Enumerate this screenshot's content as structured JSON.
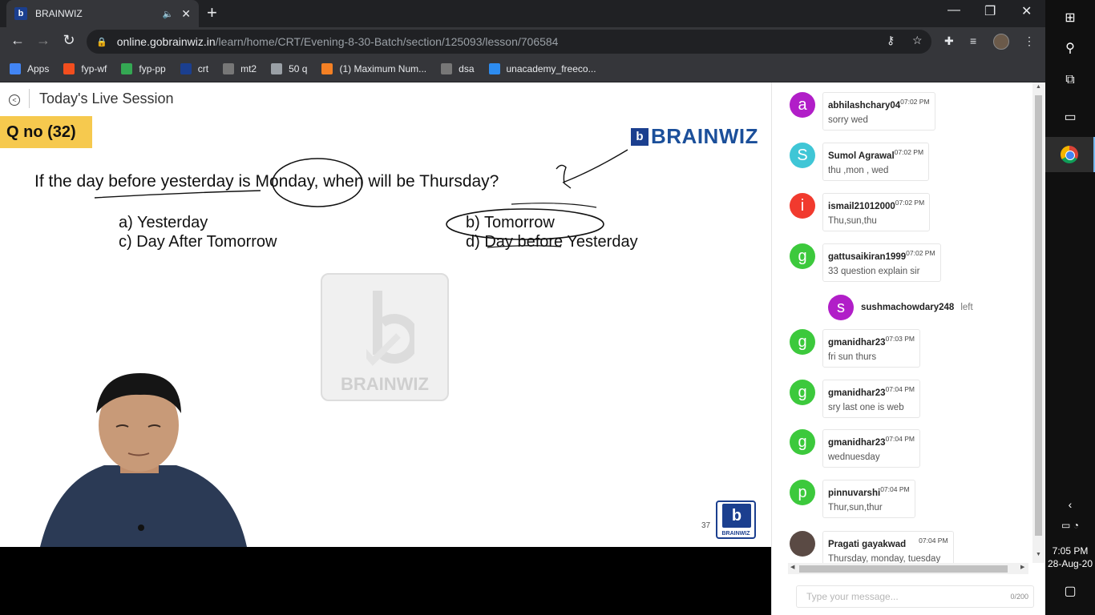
{
  "browser": {
    "tab_title": "BRAINWIZ",
    "url_host": "online.gobrainwiz.in",
    "url_path": "/learn/home/CRT/Evening-8-30-Batch/section/125093/lesson/706584",
    "bookmarks": [
      {
        "label": "Apps",
        "icon": "apps-grid-icon",
        "color": "#4285f4"
      },
      {
        "label": "fyp-wf",
        "icon": "figma-icon",
        "color": "#f24e1e"
      },
      {
        "label": "fyp-pp",
        "icon": "pp-icon",
        "color": "#34a853"
      },
      {
        "label": "crt",
        "icon": "brainwiz-icon",
        "color": "#1b3f8f"
      },
      {
        "label": "mt2",
        "icon": "cc-icon",
        "color": "#777777"
      },
      {
        "label": "50 q",
        "icon": "globe-icon",
        "color": "#9aa0a6"
      },
      {
        "label": "(1) Maximum Num...",
        "icon": "stackoverflow-icon",
        "color": "#f48024"
      },
      {
        "label": "dsa",
        "icon": "cc-icon",
        "color": "#777777"
      },
      {
        "label": "unacademy_freeco...",
        "icon": "unacademy-icon",
        "color": "#2d8cf0"
      }
    ]
  },
  "page": {
    "header_title": "Today's Live Session"
  },
  "slide": {
    "qno": "Q no (32)",
    "brand": "BRAINWIZ",
    "question": "If the day before yesterday is Monday, when will be Thursday?",
    "options": {
      "a": "a) Yesterday",
      "b": "b) Tomorrow",
      "c": "c) Day After Tomorrow",
      "d": "d) Day before Yesterday"
    },
    "watermark_text": "BRAINWIZ",
    "page_number": "37",
    "small_logo_text": "BRAINWIZ"
  },
  "chat": {
    "messages": [
      {
        "avatar_letter": "a",
        "color": "#b11ec8",
        "user": "abhilashchary04",
        "time": "07:02 PM",
        "text": "sorry wed"
      },
      {
        "avatar_letter": "S",
        "color": "#3fc6d6",
        "user": "Sumol Agrawal",
        "time": "07:02 PM",
        "text": "thu ,mon , wed"
      },
      {
        "avatar_letter": "i",
        "color": "#f13a2e",
        "user": "ismail21012000",
        "time": "07:02 PM",
        "text": "Thu,sun,thu"
      },
      {
        "avatar_letter": "g",
        "color": "#3cc93c",
        "user": "gattusaikiran1999",
        "time": "07:02 PM",
        "text": "33 question explain sir"
      },
      {
        "avatar_letter": "g",
        "color": "#3cc93c",
        "user": "gmanidhar23",
        "time": "07:03 PM",
        "text": "fri sun thurs"
      },
      {
        "avatar_letter": "g",
        "color": "#3cc93c",
        "user": "gmanidhar23",
        "time": "07:04 PM",
        "text": "sry last one is web"
      },
      {
        "avatar_letter": "g",
        "color": "#3cc93c",
        "user": "gmanidhar23",
        "time": "07:04 PM",
        "text": "wednuesday"
      },
      {
        "avatar_letter": "p",
        "color": "#3cc93c",
        "user": "pinnuvarshi",
        "time": "07:04 PM",
        "text": "Thur,sun,thur"
      },
      {
        "avatar_letter": "",
        "color": "#5a4a44",
        "user": "Pragati gayakwad",
        "time": "07:04 PM",
        "text": "Thursday, monday, tuesday"
      }
    ],
    "left_event": {
      "avatar_letter": "s",
      "color": "#b11ec8",
      "user": "sushmachowdary248",
      "note": "left"
    },
    "input_placeholder": "Type your message...",
    "char_counter": "0/200"
  },
  "taskbar": {
    "time": "7:05 PM",
    "date": "28-Aug-20"
  }
}
